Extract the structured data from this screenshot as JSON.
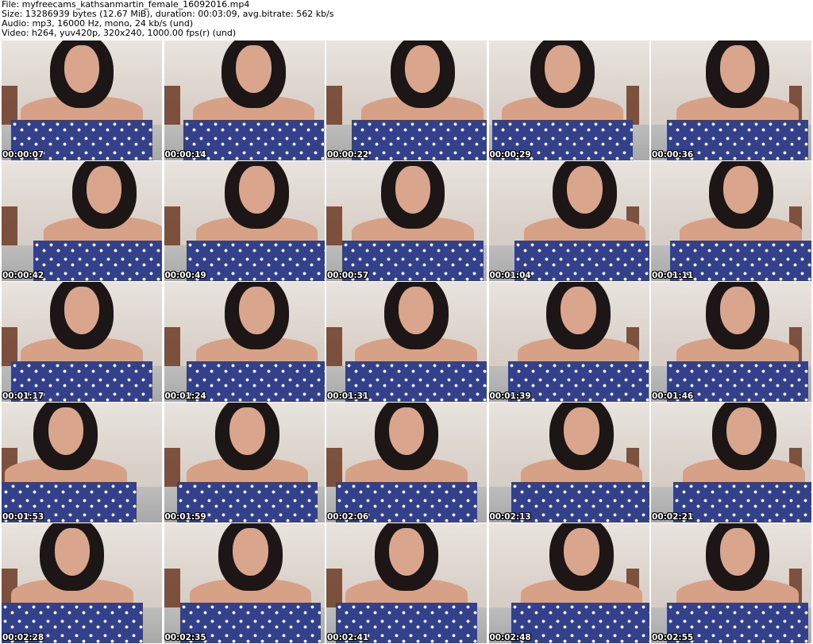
{
  "header": {
    "file_line": "File: myfreecams_kathsanmartin_female_16092016.mp4",
    "size_line": "Size: 13286939 bytes (12.67 MiB), duration: 00:03:09, avg.bitrate: 562 kb/s",
    "audio_line": "Audio: mp3, 16000 Hz, mono, 24 kb/s (und)",
    "video_line": "Video: h264, yuv420p, 320x240, 1000.00 fps(r) (und)"
  },
  "thumbnails": [
    {
      "timestamp": "00:00:07"
    },
    {
      "timestamp": "00:00:14"
    },
    {
      "timestamp": "00:00:22"
    },
    {
      "timestamp": "00:00:29"
    },
    {
      "timestamp": "00:00:36"
    },
    {
      "timestamp": "00:00:42"
    },
    {
      "timestamp": "00:00:49"
    },
    {
      "timestamp": "00:00:57"
    },
    {
      "timestamp": "00:01:04"
    },
    {
      "timestamp": "00:01:11"
    },
    {
      "timestamp": "00:01:17"
    },
    {
      "timestamp": "00:01:24"
    },
    {
      "timestamp": "00:01:31"
    },
    {
      "timestamp": "00:01:39"
    },
    {
      "timestamp": "00:01:46"
    },
    {
      "timestamp": "00:01:53"
    },
    {
      "timestamp": "00:01:59"
    },
    {
      "timestamp": "00:02:06"
    },
    {
      "timestamp": "00:02:13"
    },
    {
      "timestamp": "00:02:21"
    },
    {
      "timestamp": "00:02:28"
    },
    {
      "timestamp": "00:02:35"
    },
    {
      "timestamp": "00:02:41"
    },
    {
      "timestamp": "00:02:48"
    },
    {
      "timestamp": "00:02:55"
    }
  ]
}
